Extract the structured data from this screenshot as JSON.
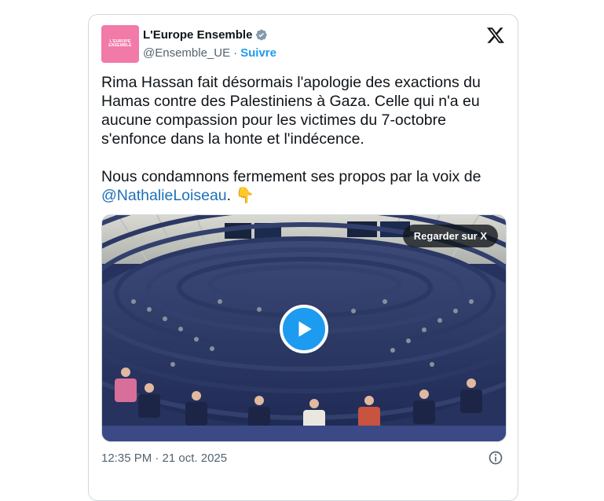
{
  "author": {
    "display_name": "L'Europe Ensemble",
    "handle": "@Ensemble_UE",
    "separator": "·",
    "follow_label": "Suivre",
    "avatar_text": "L'EUROPE ENSEMBLE",
    "avatar_color": "#f27aa8",
    "verified_icon": "verified-badge-icon"
  },
  "platform_icon": "x-logo-icon",
  "tweet": {
    "paragraph1": "Rima Hassan fait désormais l'apologie des exactions du Hamas contre des Palestiniens à Gaza. Celle qui n'a eu aucune compassion pour les victimes du 7-octobre s'enfonce dans la honte et l'indécence.",
    "paragraph2_prefix": "Nous condamnons fermement ses propos par la voix de",
    "mention": "@NathalieLoiseau",
    "paragraph2_suffix": ".",
    "emoji": "👇"
  },
  "media": {
    "watch_label": "Regarder sur X",
    "play_icon": "play-icon"
  },
  "timestamp": "12:35 PM · 21 oct. 2025",
  "info_icon": "info-icon",
  "colors": {
    "accent": "#1d9bf0",
    "text": "#0f1419",
    "muted": "#536471",
    "border": "#cfd9de"
  }
}
